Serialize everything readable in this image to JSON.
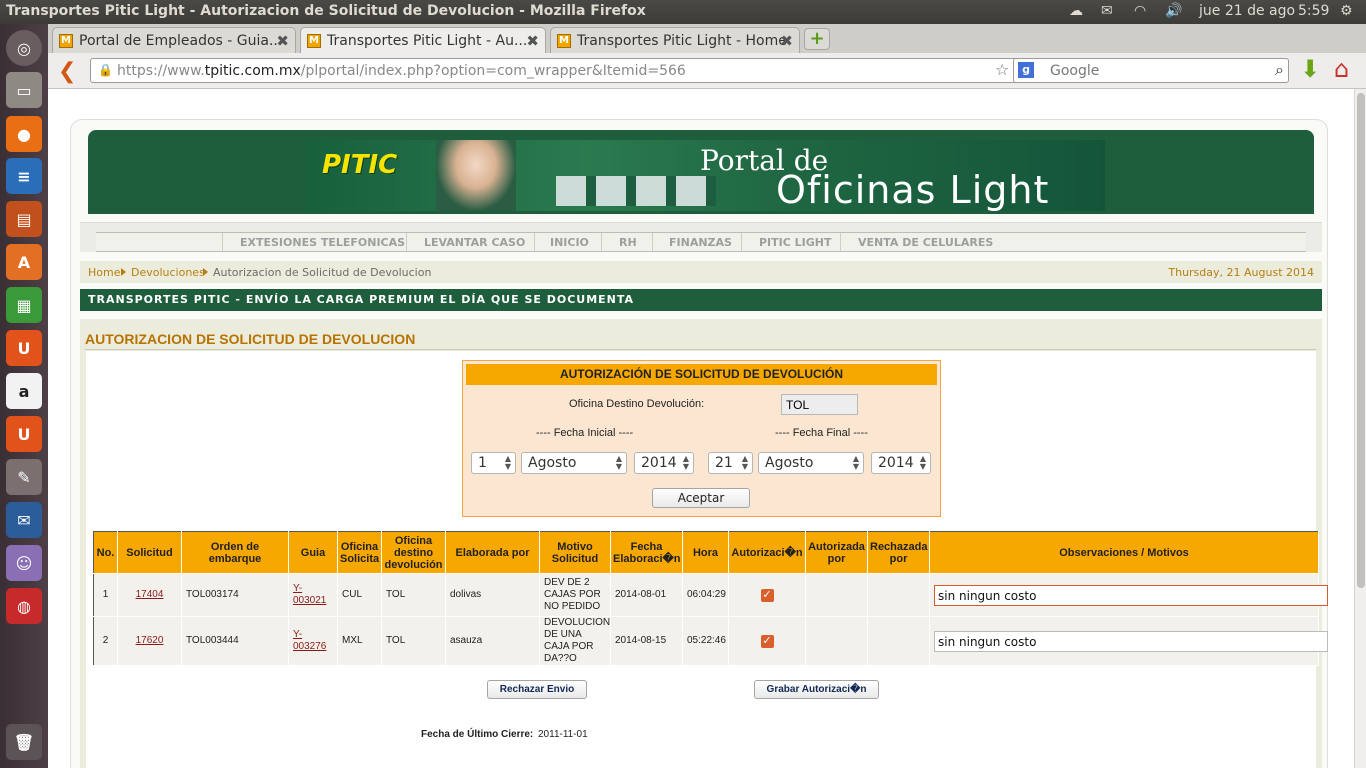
{
  "system": {
    "window_title": "Transportes Pitic Light - Autorizacion de Solicitud de Devolucion - Mozilla Firefox",
    "date": "jue 21 de ago",
    "time": "5:59"
  },
  "tabs": [
    {
      "label": "Portal de Empleados - Guia...",
      "active": false
    },
    {
      "label": "Transportes Pitic Light - Au...",
      "active": true
    },
    {
      "label": "Transportes Pitic Light - Home",
      "active": false
    }
  ],
  "nav": {
    "url_prefix": "https://www.",
    "url_domain": "tpitic.com.mx",
    "url_path": "/plportal/index.php?option=com_wrapper&Itemid=566",
    "search_placeholder": "Google"
  },
  "banner": {
    "logo": "PITIC",
    "line1": "Portal de",
    "line2": "Oficinas Light"
  },
  "menu": [
    "EXTESIONES TELEFONICAS",
    "LEVANTAR CASO",
    "INICIO",
    "RH",
    "FINANZAS",
    "PITIC LIGHT",
    "VENTA DE CELULARES"
  ],
  "breadcrumb": {
    "home": "Home",
    "section": "Devoluciones",
    "current": "Autorizacion de Solicitud de Devolucion",
    "date": "Thursday, 21 August 2014"
  },
  "slogan": "TRANSPORTES PITIC - ENVÍO LA CARGA PREMIUM EL DÍA QUE SE DOCUMENTA",
  "page_title": "AUTORIZACION DE SOLICITUD DE DEVOLUCION",
  "form": {
    "heading": "AUTORIZACIÓN DE SOLICITUD DE DEVOLUCIÓN",
    "office_label": "Oficina Destino Devolución:",
    "office_value": "TOL",
    "start_label": "---- Fecha Inicial ----",
    "end_label": "---- Fecha Final ----",
    "start_day": "1",
    "start_month": "Agosto",
    "start_year": "2014",
    "end_day": "21",
    "end_month": "Agosto",
    "end_year": "2014",
    "accept_label": "Aceptar"
  },
  "table": {
    "headers": [
      "No.",
      "Solicitud",
      "Orden de embarque",
      "Guia",
      "Oficina Solicita",
      "Oficina destino devolución",
      "Elaborada por",
      "Motivo Solicitud",
      "Fecha Elaboraci�n",
      "Hora",
      "Autorizaci�n",
      "Autorizada por",
      "Rechazada por",
      "Observaciones / Motivos"
    ],
    "rows": [
      {
        "no": "1",
        "solicitud": "17404",
        "orden": "TOL003174",
        "guia": "Y-003021",
        "oficina_solicita": "CUL",
        "oficina_destino": "TOL",
        "elaborada": "dolivas",
        "motivo": "DEV DE 2 CAJAS POR NO PEDIDO",
        "fecha": "2014-08-01",
        "hora": "06:04:29",
        "autorizacion": true,
        "autorizada_por": "",
        "rechazada_por": "",
        "observaciones": "sin ningun costo"
      },
      {
        "no": "2",
        "solicitud": "17620",
        "orden": "TOL003444",
        "guia": "Y-003276",
        "oficina_solicita": "MXL",
        "oficina_destino": "TOL",
        "elaborada": "asauza",
        "motivo": "DEVOLUCION DE UNA CAJA POR DA??O",
        "fecha": "2014-08-15",
        "hora": "05:22:46",
        "autorizacion": true,
        "autorizada_por": "",
        "rechazada_por": "",
        "observaciones": "sin ningun costo"
      }
    ]
  },
  "actions": {
    "reject_label": "Rechazar Envio",
    "save_label": "Grabar Autorizaci�n"
  },
  "footer": {
    "close_label": "Fecha de Último Cierre:",
    "close_value": "2011-11-01"
  }
}
